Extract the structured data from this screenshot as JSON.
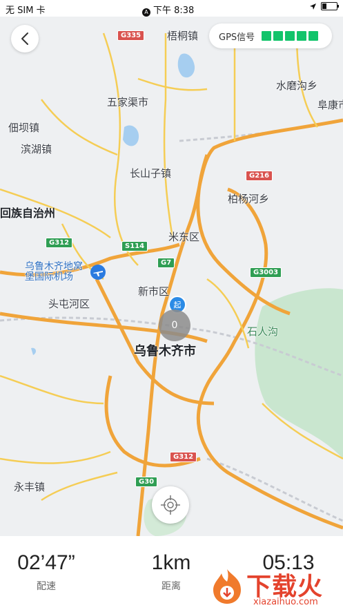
{
  "status_bar": {
    "carrier": "无 SIM 卡",
    "time": "下午 8:38"
  },
  "gps": {
    "label": "GPS信号",
    "bars": 5
  },
  "map": {
    "places": {
      "wutong": "梧桐镇",
      "wujiaqu": "五家渠市",
      "shuimogou": "水磨沟乡",
      "fukang": "阜康市",
      "dianba": "佃坝镇",
      "binhu": "滨湖镇",
      "changshanzi": "长山子镇",
      "baiyanghe": "柏杨河乡",
      "huizu": "回族自治州",
      "midong": "米东区",
      "airport": "乌鲁木齐地窝\n堡国际机场",
      "xinshi": "新市区",
      "toutunhe": "头屯河区",
      "shirengou": "石人沟",
      "urumqi": "乌鲁木齐市",
      "yongfeng": "永丰镇"
    },
    "shields": {
      "g335": "G335",
      "g216": "G216",
      "g312a": "G312",
      "s114": "S114",
      "g7": "G7",
      "g3003": "G3003",
      "g312b": "G312",
      "g30": "G30"
    },
    "marker_count": "0",
    "start_label": "起"
  },
  "stats": {
    "pace": {
      "value": "02’47”",
      "label": "配速"
    },
    "distance": {
      "value": "1km",
      "label": "距离"
    },
    "time": {
      "value": "05:13",
      "label": ""
    }
  },
  "watermark": {
    "title": "下载火",
    "domain": "xiazaihuo.com"
  }
}
